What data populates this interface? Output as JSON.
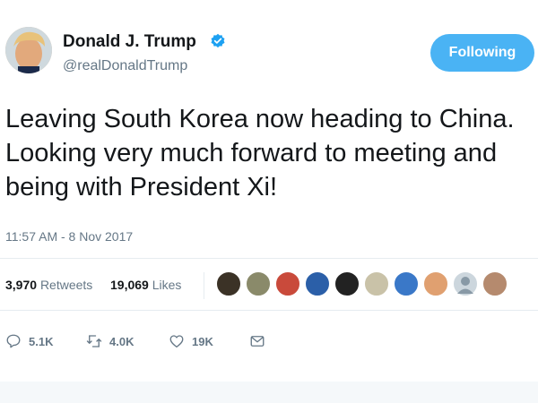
{
  "author": {
    "name": "Donald J. Trump",
    "handle": "@realDonaldTrump",
    "verified": true
  },
  "follow_button": {
    "label": "Following"
  },
  "tweet": {
    "text": "Leaving South Korea now heading to China.\nLooking very much forward to meeting and\nbeing with President Xi!",
    "timestamp": "11:57 AM - 8 Nov 2017"
  },
  "stats": {
    "retweets_count": "3,970",
    "retweets_label": "Retweets",
    "likes_count": "19,069",
    "likes_label": "Likes"
  },
  "likers": [
    {
      "icon": "liker-avatar-1",
      "color": "#3b3226"
    },
    {
      "icon": "liker-avatar-2",
      "color": "#8a8a6a"
    },
    {
      "icon": "liker-avatar-3",
      "color": "#c94a3b"
    },
    {
      "icon": "liker-avatar-4",
      "color": "#2b5fa8"
    },
    {
      "icon": "liker-avatar-5",
      "color": "#222222"
    },
    {
      "icon": "liker-avatar-6",
      "color": "#c9c2a8"
    },
    {
      "icon": "liker-avatar-7",
      "color": "#3a78c8"
    },
    {
      "icon": "liker-avatar-8",
      "color": "#e0a070"
    },
    {
      "icon": "liker-avatar-default",
      "color": "#ccd6dd"
    },
    {
      "icon": "liker-avatar-9",
      "color": "#b58a6e"
    }
  ],
  "actions": {
    "reply_count": "5.1K",
    "retweet_count": "4.0K",
    "like_count": "19K"
  },
  "colors": {
    "accent": "#4ab3f4",
    "verified": "#1da1f2",
    "secondary_text": "#657786"
  },
  "icons": {
    "verified": "verified-badge-icon",
    "reply": "reply-icon",
    "retweet": "retweet-icon",
    "like": "heart-icon",
    "message": "envelope-icon"
  }
}
